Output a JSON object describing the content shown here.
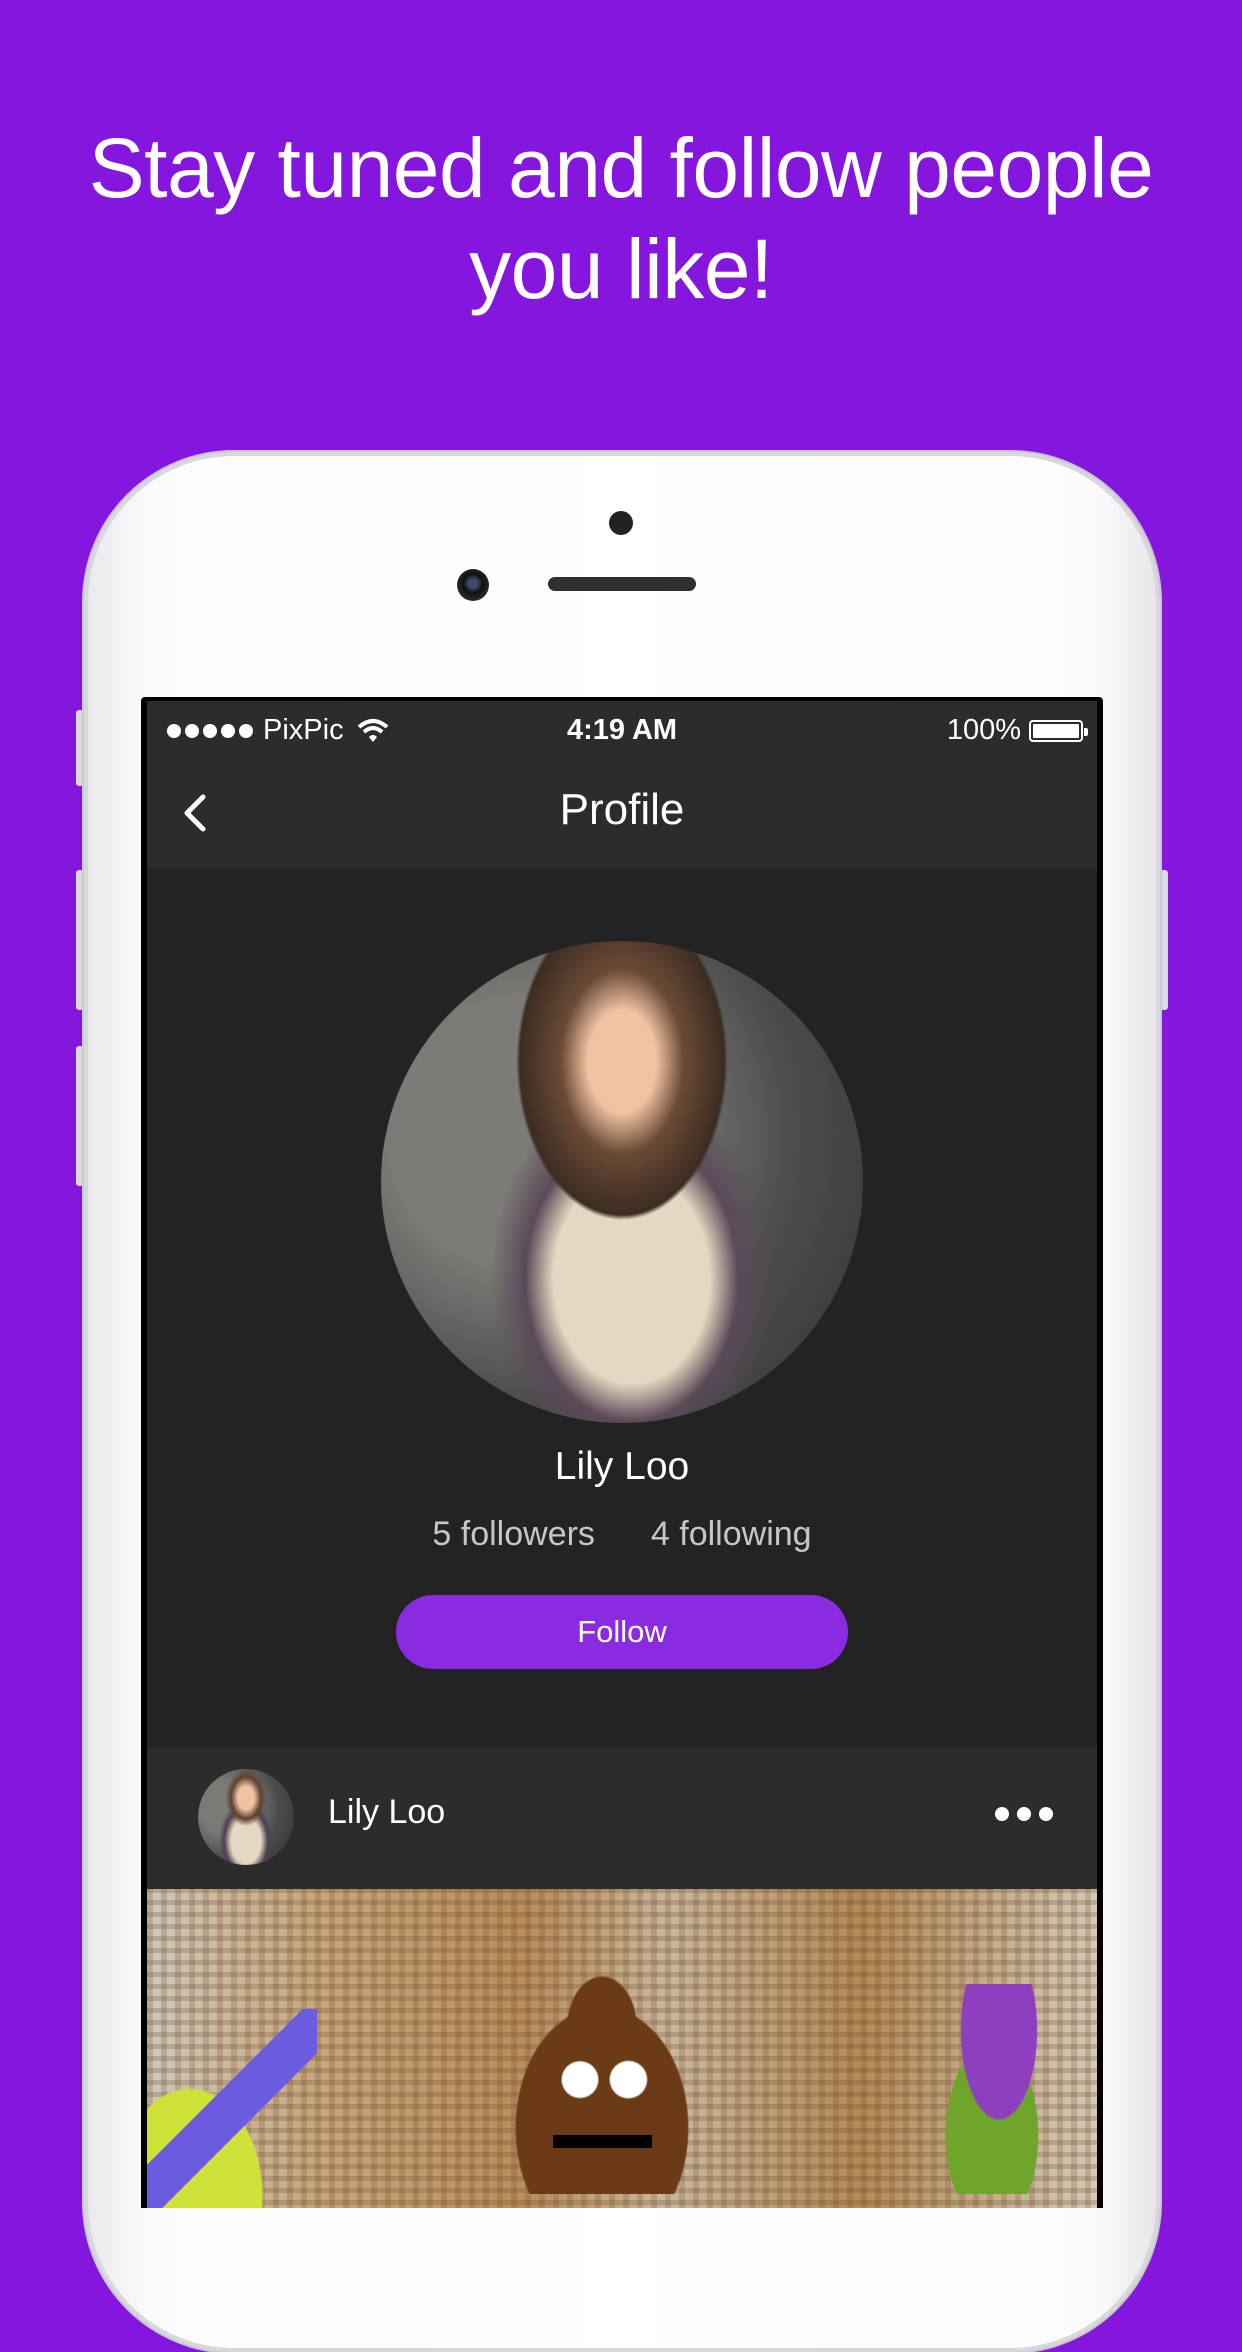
{
  "headline": {
    "line1": "Stay tuned and follow people",
    "line2": "you like!"
  },
  "colors": {
    "background": "#8416dd",
    "accent_button": "#8a2be2",
    "screen_bg": "#232323",
    "bar_bg": "#2c2c2c"
  },
  "status_bar": {
    "carrier": "PixPic",
    "time": "4:19 AM",
    "battery": "100%",
    "signal_icon": "signal-dots-icon",
    "wifi_icon": "wifi-icon",
    "battery_icon": "battery-icon"
  },
  "navbar": {
    "back_icon": "chevron-left-icon",
    "title": "Profile"
  },
  "profile": {
    "name": "Lily Loo",
    "followers": "5 followers",
    "following": "4 following",
    "follow_label": "Follow"
  },
  "post": {
    "author": "Lily Loo",
    "more_icon": "more-dots-icon"
  }
}
